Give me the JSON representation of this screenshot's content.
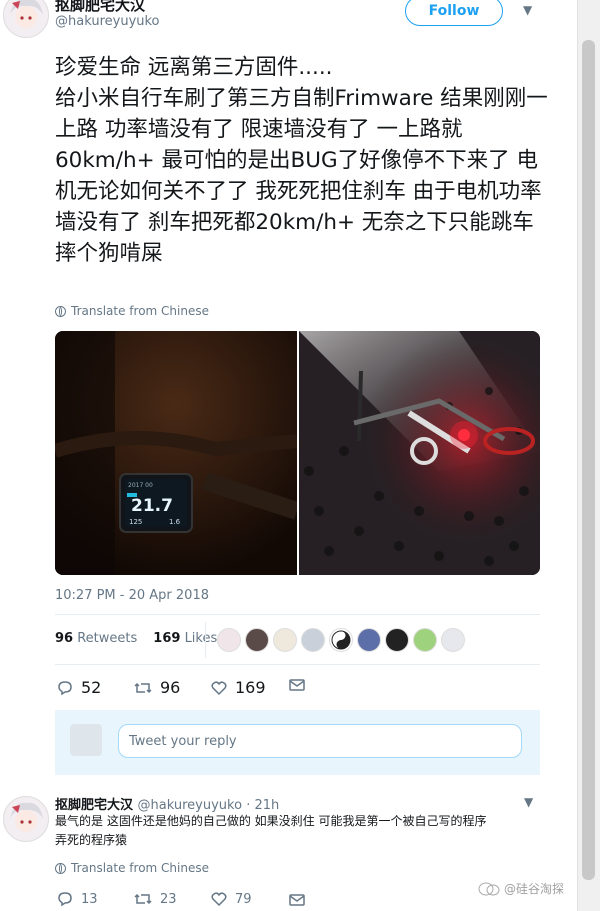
{
  "tweet": {
    "author_name": "抠脚肥宅大汉",
    "author_handle": "@hakureyuyuko",
    "follow_label": "Follow",
    "text": "珍爱生命 远离第三方固件.....\n给小米自行车刷了第三方自制Frimware 结果刚刚一上路 功率墙没有了 限速墙没有了 一上路就60km/h+ 最可怕的是出BUG了好像停不下来了 电机无论如何关不了了 我死死把住刹车 由于电机功率墙没有了 刹车把死都20km/h+ 无奈之下只能跳车摔个狗啃屎",
    "translate_label": "Translate from Chinese",
    "media": {
      "display_speed": "21.7",
      "display_small_left": "125",
      "display_small_right": "1.6",
      "display_top_small": "2017 00"
    },
    "timestamp": "10:27 PM - 20 Apr 2018",
    "retweets_count": "96",
    "retweets_label": "Retweets",
    "likes_count": "169",
    "likes_label": "Likes",
    "actions": {
      "replies": "52",
      "retweets": "96",
      "likes": "169"
    }
  },
  "reply_box": {
    "placeholder": "Tweet your reply"
  },
  "reply": {
    "author_name": "抠脚肥宅大汉",
    "author_handle": "@hakureyuyuko · 21h",
    "text": "最气的是 这固件还是他妈的自己做的 如果没刹住 可能我是第一个被自己写的程序\n弄死的程序猿",
    "translate_label": "Translate from Chinese",
    "actions": {
      "replies": "13",
      "retweets": "23",
      "likes": "79"
    }
  },
  "watermark": "@硅谷淘探",
  "colors": {
    "accent": "#1da1f2",
    "text": "#14171a",
    "muted": "#657786"
  }
}
